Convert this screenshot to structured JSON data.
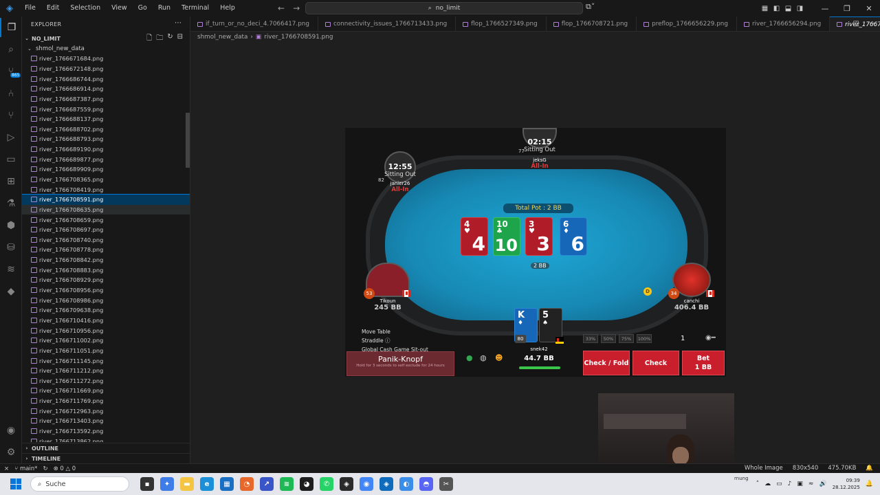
{
  "titlebar": {
    "menu": [
      "File",
      "Edit",
      "Selection",
      "View",
      "Go",
      "Run",
      "Terminal",
      "Help"
    ],
    "search": "no_limit"
  },
  "activity": {
    "badge": "865"
  },
  "explorer": {
    "title": "EXPLORER",
    "root": "NO_LIMIT",
    "folder": "shmol_new_data",
    "files": [
      "river_1766671684.png",
      "river_1766672148.png",
      "river_1766686744.png",
      "river_1766686914.png",
      "river_1766687387.png",
      "river_1766687559.png",
      "river_1766688137.png",
      "river_1766688702.png",
      "river_1766688793.png",
      "river_1766689190.png",
      "river_1766689877.png",
      "river_1766689909.png",
      "river_1766708365.png",
      "river_1766708419.png",
      "river_1766708591.png",
      "river_1766708635.png",
      "river_1766708659.png",
      "river_1766708697.png",
      "river_1766708740.png",
      "river_1766708778.png",
      "river_1766708842.png",
      "river_1766708883.png",
      "river_1766708929.png",
      "river_1766708956.png",
      "river_1766708986.png",
      "river_1766709638.png",
      "river_1766710416.png",
      "river_1766710956.png",
      "river_1766711002.png",
      "river_1766711051.png",
      "river_1766711145.png",
      "river_1766711212.png",
      "river_1766711272.png",
      "river_1766711669.png",
      "river_1766711769.png",
      "river_1766712963.png",
      "river_1766713403.png",
      "river_1766713592.png",
      "river_1766713862.png"
    ],
    "selected_index": 14,
    "hover_index": 15,
    "outline": "OUTLINE",
    "timeline": "TIMELINE"
  },
  "tabs": [
    {
      "label": "if_turn_or_no_deci_4.7066417.png",
      "active": false
    },
    {
      "label": "connectivity_issues_1766713433.png",
      "active": false
    },
    {
      "label": "flop_1766527349.png",
      "active": false
    },
    {
      "label": "flop_1766708721.png",
      "active": false
    },
    {
      "label": "preflop_1766656229.png",
      "active": false
    },
    {
      "label": "river_1766656294.png",
      "active": false
    },
    {
      "label": "river_1766708591.png",
      "active": true
    }
  ],
  "breadcrumb": {
    "folder": "shmol_new_data",
    "file": "river_1766708591.png"
  },
  "poker": {
    "pot": "Total Pot : 2 BB",
    "pot_chip": "2 BB",
    "board": [
      {
        "rank": "4",
        "suit": "♥",
        "color": "#b01c28"
      },
      {
        "rank": "10",
        "suit": "♣",
        "color": "#1ea54b"
      },
      {
        "rank": "3",
        "suit": "♥",
        "color": "#b01c28"
      },
      {
        "rank": "6",
        "suit": "♦",
        "color": "#1667b7"
      }
    ],
    "seats": {
      "top": {
        "timer": "02:15",
        "status": "Sitting Out",
        "name": "jeksG",
        "allin": "All-In",
        "level": "77"
      },
      "topleft": {
        "timer": "12:55",
        "status": "Sitting Out",
        "name": "janier26",
        "allin": "All-In",
        "level": "82"
      },
      "left": {
        "name": "Tikoun",
        "stack": "245 BB",
        "level": "53"
      },
      "right": {
        "name": "canchi",
        "stack": "406.4 BB",
        "level": "34"
      },
      "hero": {
        "name": "snek42",
        "stack": "44.7 BB",
        "level": "80",
        "card1": "K",
        "card2": "5"
      }
    },
    "dealer": "D",
    "controls": {
      "move_table": "Move Table",
      "straddle": "Straddle",
      "sitout": "Global Cash Game Sit-out",
      "panik": "Panik-Knopf",
      "panik_sub": "Hold for 3 seconds to self exclude for 24 hours",
      "sizes": [
        "33%",
        "50%",
        "75%",
        "100%"
      ],
      "bet_amount": "1",
      "check_fold": "Check / Fold",
      "check": "Check",
      "bet": "Bet",
      "bet_sub": "1 BB"
    }
  },
  "statusbar": {
    "branch": "main*",
    "problems": "0 △ 0",
    "whole_image": "Whole Image",
    "dims": "830x540",
    "size": "475.70KB"
  },
  "taskbar": {
    "search": "Suche",
    "time": "09:39",
    "date": "28.12.2025",
    "warning": "rnung"
  }
}
